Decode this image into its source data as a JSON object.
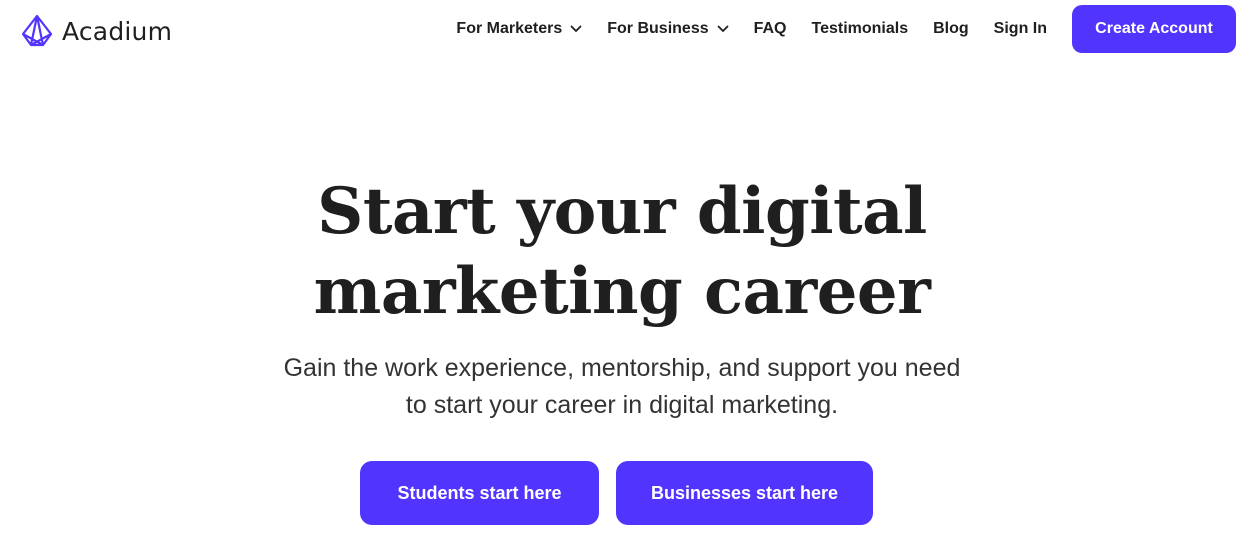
{
  "brand": {
    "name": "Acadium",
    "accent_color": "#5135FF"
  },
  "nav": {
    "items": [
      {
        "label": "For Marketers",
        "icon": "chevron-down-icon"
      },
      {
        "label": "For Business",
        "icon": "chevron-down-icon"
      },
      {
        "label": "FAQ"
      },
      {
        "label": "Testimonials"
      },
      {
        "label": "Blog"
      },
      {
        "label": "Sign In"
      }
    ],
    "cta_label": "Create Account"
  },
  "hero": {
    "title_line1": "Start your digital",
    "title_line2": "marketing career",
    "subtitle_line1": "Gain the work experience, mentorship, and support you need",
    "subtitle_line2": "to start your career in digital marketing.",
    "primary_cta": "Students start here",
    "secondary_cta": "Businesses start here"
  }
}
